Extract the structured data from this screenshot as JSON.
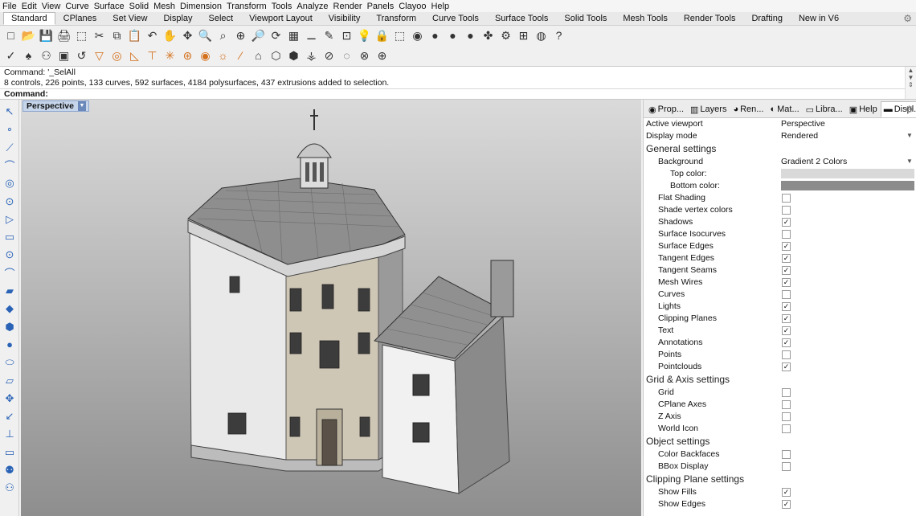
{
  "menu": [
    "File",
    "Edit",
    "View",
    "Curve",
    "Surface",
    "Solid",
    "Mesh",
    "Dimension",
    "Transform",
    "Tools",
    "Analyze",
    "Render",
    "Panels",
    "Clayoo",
    "Help"
  ],
  "tabs": [
    "Standard",
    "CPlanes",
    "Set View",
    "Display",
    "Select",
    "Viewport Layout",
    "Visibility",
    "Transform",
    "Curve Tools",
    "Surface Tools",
    "Solid Tools",
    "Mesh Tools",
    "Render Tools",
    "Drafting",
    "New in V6"
  ],
  "active_tab": "Standard",
  "toolbar_row1": [
    {
      "icon": "□",
      "name": "new-file-icon"
    },
    {
      "icon": "📂",
      "name": "open-file-icon"
    },
    {
      "icon": "💾",
      "name": "save-icon"
    },
    {
      "icon": "🖨",
      "name": "print-icon"
    },
    {
      "icon": "⬚",
      "name": "import-icon"
    },
    {
      "icon": "✂",
      "name": "cut-icon"
    },
    {
      "icon": "⧉",
      "name": "copy-icon"
    },
    {
      "icon": "📋",
      "name": "paste-icon"
    },
    {
      "icon": "↶",
      "name": "undo-icon"
    },
    {
      "icon": "✋",
      "name": "pan-icon"
    },
    {
      "icon": "✥",
      "name": "move-view-icon"
    },
    {
      "icon": "🔍",
      "name": "zoom-icon"
    },
    {
      "icon": "⌕",
      "name": "zoom-window-icon"
    },
    {
      "icon": "⊕",
      "name": "zoom-extents-icon"
    },
    {
      "icon": "🔎",
      "name": "zoom-selected-icon"
    },
    {
      "icon": "⟳",
      "name": "rotate-view-icon"
    },
    {
      "icon": "▦",
      "name": "four-view-icon"
    },
    {
      "icon": "⚊",
      "name": "layer-icon"
    },
    {
      "icon": "✎",
      "name": "properties-icon"
    },
    {
      "icon": "⊡",
      "name": "select-icon"
    },
    {
      "icon": "💡",
      "name": "light-icon"
    },
    {
      "icon": "🔒",
      "name": "lock-icon"
    },
    {
      "icon": "⬚",
      "name": "hide-icon"
    },
    {
      "icon": "◉",
      "name": "color-wheel-icon"
    },
    {
      "icon": "●",
      "name": "material-sphere-icon"
    },
    {
      "icon": "●",
      "name": "render-sphere-icon"
    },
    {
      "icon": "●",
      "name": "render-preview-icon"
    },
    {
      "icon": "✤",
      "name": "options-icon"
    },
    {
      "icon": "⚙",
      "name": "settings-icon"
    },
    {
      "icon": "⊞",
      "name": "grid-snap-icon"
    },
    {
      "icon": "◍",
      "name": "globe-icon"
    },
    {
      "icon": "?",
      "name": "help-icon"
    }
  ],
  "toolbar_row2": [
    {
      "icon": "✓",
      "name": "check-icon"
    },
    {
      "icon": "♠",
      "name": "clayoo-icon"
    },
    {
      "icon": "⚇",
      "name": "clayoo-mesh-icon"
    },
    {
      "icon": "▣",
      "name": "box-icon"
    },
    {
      "icon": "↺",
      "name": "subd-icon"
    },
    {
      "icon": "▽",
      "name": "shape-icon"
    },
    {
      "icon": "◎",
      "name": "circle-icon"
    },
    {
      "icon": "◺",
      "name": "triangle-icon"
    },
    {
      "icon": "⊤",
      "name": "extrude-icon"
    },
    {
      "icon": "✳",
      "name": "explode-icon"
    },
    {
      "icon": "⊛",
      "name": "target-icon"
    },
    {
      "icon": "◉",
      "name": "ring-icon"
    },
    {
      "icon": "☼",
      "name": "sun-icon"
    },
    {
      "icon": "⁄",
      "name": "crease-icon"
    },
    {
      "icon": "⌂",
      "name": "house-icon"
    },
    {
      "icon": "⬡",
      "name": "cube-icon"
    },
    {
      "icon": "⬢",
      "name": "solid-cube-icon"
    },
    {
      "icon": "⚶",
      "name": "grass-icon"
    },
    {
      "icon": "⊘",
      "name": "mask-icon"
    },
    {
      "icon": "◌",
      "name": "sphere-mesh-icon"
    },
    {
      "icon": "⊗",
      "name": "cross-icon"
    },
    {
      "icon": "⊕",
      "name": "add-icon"
    }
  ],
  "command": {
    "line1": "Command: '_SelAll",
    "line2": "8 controls, 226 points, 133 curves, 592 surfaces, 4184 polysurfaces, 437 extrusions added to selection.",
    "prompt": "Command:"
  },
  "left_tools": [
    {
      "icon": "↖",
      "name": "select-arrow-icon"
    },
    {
      "icon": "∘",
      "name": "point-icon"
    },
    {
      "icon": "⟋",
      "name": "polyline-icon"
    },
    {
      "icon": "⌒",
      "name": "curve-icon"
    },
    {
      "icon": "◎",
      "name": "circle-tool-icon"
    },
    {
      "icon": "⊙",
      "name": "ellipse-icon"
    },
    {
      "icon": "▷",
      "name": "polygon-icon"
    },
    {
      "icon": "▭",
      "name": "rectangle-icon"
    },
    {
      "icon": "⊙",
      "name": "arc-icon"
    },
    {
      "icon": "⌒",
      "name": "fillet-icon"
    },
    {
      "icon": "▰",
      "name": "surface-icon"
    },
    {
      "icon": "◆",
      "name": "extrude-surface-icon"
    },
    {
      "icon": "⬢",
      "name": "box-solid-icon"
    },
    {
      "icon": "●",
      "name": "sphere-icon"
    },
    {
      "icon": "⬭",
      "name": "cylinder-icon"
    },
    {
      "icon": "▱",
      "name": "mesh-icon"
    },
    {
      "icon": "✥",
      "name": "transform-tool-icon"
    },
    {
      "icon": "↙",
      "name": "move-tool-icon"
    },
    {
      "icon": "⊥",
      "name": "dimension-icon"
    },
    {
      "icon": "▭",
      "name": "block-icon"
    },
    {
      "icon": "⚉",
      "name": "group-icon"
    },
    {
      "icon": "⚇",
      "name": "analyze-icon"
    }
  ],
  "viewport": {
    "title": "Perspective"
  },
  "panel_tabs": [
    {
      "label": "Prop...",
      "icon": "◉",
      "name": "properties-tab-icon"
    },
    {
      "label": "Layers",
      "icon": "▥",
      "name": "layers-tab-icon"
    },
    {
      "label": "Ren...",
      "icon": "◕",
      "name": "rendering-tab-icon"
    },
    {
      "label": "Mat...",
      "icon": "◐",
      "name": "materials-tab-icon"
    },
    {
      "label": "Libra...",
      "icon": "▭",
      "name": "libraries-tab-icon"
    },
    {
      "label": "Help",
      "icon": "▣",
      "name": "help-tab-icon"
    },
    {
      "label": "Displ...",
      "icon": "▬",
      "name": "display-tab-icon"
    }
  ],
  "active_panel_tab": "Displ...",
  "display_panel": {
    "active_viewport_label": "Active viewport",
    "active_viewport_value": "Perspective",
    "display_mode_label": "Display mode",
    "display_mode_value": "Rendered",
    "general_header": "General settings",
    "background_label": "Background",
    "background_value": "Gradient 2 Colors",
    "top_color_label": "Top color:",
    "top_color": "#d9d9d9",
    "bottom_color_label": "Bottom color:",
    "bottom_color": "#8c8c8c",
    "general_items": [
      {
        "label": "Flat Shading",
        "checked": false
      },
      {
        "label": "Shade vertex colors",
        "checked": false
      },
      {
        "label": "Shadows",
        "checked": true
      },
      {
        "label": "Surface Isocurves",
        "checked": false
      },
      {
        "label": "Surface Edges",
        "checked": true
      },
      {
        "label": "Tangent Edges",
        "checked": true
      },
      {
        "label": "Tangent Seams",
        "checked": true
      },
      {
        "label": "Mesh Wires",
        "checked": true
      },
      {
        "label": "Curves",
        "checked": false
      },
      {
        "label": "Lights",
        "checked": true
      },
      {
        "label": "Clipping Planes",
        "checked": true
      },
      {
        "label": "Text",
        "checked": true
      },
      {
        "label": "Annotations",
        "checked": true
      },
      {
        "label": "Points",
        "checked": false
      },
      {
        "label": "Pointclouds",
        "checked": true
      }
    ],
    "grid_header": "Grid & Axis settings",
    "grid_items": [
      {
        "label": "Grid",
        "checked": false
      },
      {
        "label": "CPlane Axes",
        "checked": false
      },
      {
        "label": "Z Axis",
        "checked": false
      },
      {
        "label": "World Icon",
        "checked": false
      }
    ],
    "object_header": "Object settings",
    "object_items": [
      {
        "label": "Color Backfaces",
        "checked": false
      },
      {
        "label": "BBox Display",
        "checked": false
      }
    ],
    "clip_header": "Clipping Plane settings",
    "clip_items": [
      {
        "label": "Show Fills",
        "checked": true
      },
      {
        "label": "Show Edges",
        "checked": true
      }
    ]
  },
  "colors": {
    "viewport_top": "#dadada",
    "viewport_bottom": "#8e8e8e",
    "accent": "#2a63b6"
  }
}
